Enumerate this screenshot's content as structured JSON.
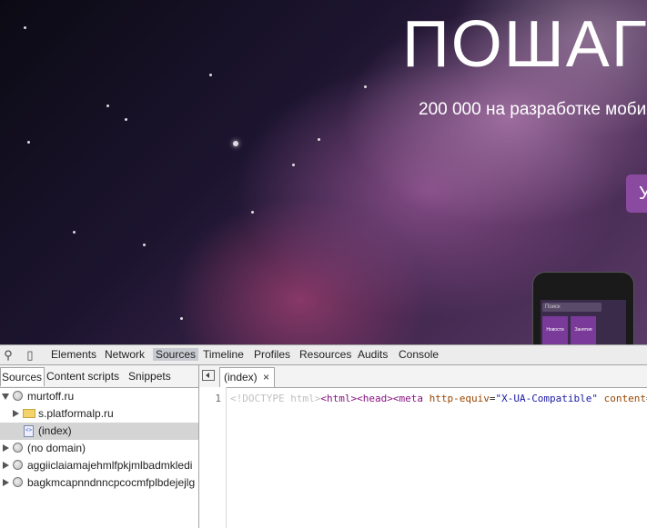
{
  "page": {
    "hero_title": "ПОШАГ",
    "hero_subtitle": "200 000 на разработке моби",
    "hero_button": "У",
    "phone": {
      "search_placeholder": "Поиск",
      "tile_1": "Новости",
      "tile_2": "Занятия"
    }
  },
  "devtools": {
    "tabs": [
      "Elements",
      "Network",
      "Sources",
      "Timeline",
      "Profiles",
      "Resources",
      "Audits",
      "Console"
    ],
    "active_tab": "Sources",
    "sources_panel": {
      "tabs": [
        "Sources",
        "Content scripts",
        "Snippets"
      ],
      "active_tab": "Sources",
      "tree": [
        {
          "label": "murtoff.ru",
          "icon": "globe-icon",
          "expanded": true
        },
        {
          "label": "s.platformalp.ru",
          "icon": "folder-icon",
          "expanded": false
        },
        {
          "label": "(index)",
          "icon": "file-icon",
          "selected": true
        },
        {
          "label": "(no domain)",
          "icon": "globe-icon",
          "expanded": false
        },
        {
          "label": "aggiiclaiamajehmlfpkjmlbadmkledi",
          "icon": "globe-icon",
          "expanded": false
        },
        {
          "label": "bagkmcapnndnncpcocmfplbdejejlg",
          "icon": "globe-icon",
          "expanded": false
        }
      ]
    },
    "editor": {
      "open_file": "(index)",
      "close_glyph": "×",
      "line_number": "1",
      "code": {
        "doctype": "<!DOCTYPE html>",
        "html_tag": "<html>",
        "head_tag": "<head>",
        "meta_open": "<meta",
        "attr1_name": "http-equiv",
        "attr1_value": "\"X-UA-Compatible\"",
        "attr2_name": "content"
      }
    }
  },
  "colors": {
    "active_tab_bg": "#c7cbd1",
    "selected_row_bg": "#d4d4d4",
    "tag_color": "#881280",
    "attr_color": "#994500",
    "value_color": "#1a1aa6",
    "hero_button_bg": "#8a4aa0"
  }
}
